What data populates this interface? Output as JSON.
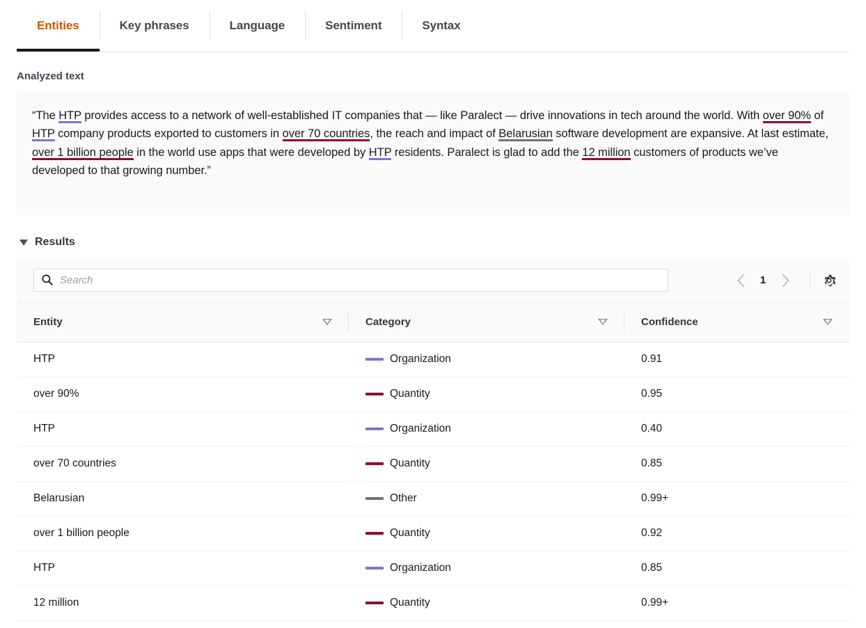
{
  "tabs": [
    {
      "label": "Entities",
      "active": true
    },
    {
      "label": "Key phrases",
      "active": false
    },
    {
      "label": "Language",
      "active": false
    },
    {
      "label": "Sentiment",
      "active": false
    },
    {
      "label": "Syntax",
      "active": false
    }
  ],
  "analyzed": {
    "section_label": "Analyzed text",
    "segments": [
      {
        "text": "“The ",
        "type": "plain"
      },
      {
        "text": "HTP",
        "type": "org"
      },
      {
        "text": " provides access to a network of well-established IT companies that — like Paralect — drive innovations in tech around the world. With ",
        "type": "plain"
      },
      {
        "text": "over 90%",
        "type": "qty"
      },
      {
        "text": " of ",
        "type": "plain"
      },
      {
        "text": "HTP",
        "type": "org"
      },
      {
        "text": " company products exported to customers in ",
        "type": "plain"
      },
      {
        "text": "over 70 countries",
        "type": "qty"
      },
      {
        "text": ", the reach and impact of ",
        "type": "plain"
      },
      {
        "text": "Belarusian",
        "type": "other"
      },
      {
        "text": " software development are expansive. At last estimate, ",
        "type": "plain"
      },
      {
        "text": "over 1 billion people",
        "type": "qty"
      },
      {
        "text": " in the world use apps that were developed by ",
        "type": "plain"
      },
      {
        "text": "HTP",
        "type": "org"
      },
      {
        "text": " residents. Paralect is glad to add the ",
        "type": "plain"
      },
      {
        "text": "12 million",
        "type": "qty"
      },
      {
        "text": " customers of products we’ve developed to that growing number.”",
        "type": "plain"
      }
    ]
  },
  "results": {
    "title": "Results",
    "search": {
      "placeholder": "Search",
      "value": ""
    },
    "pagination": {
      "page": "1",
      "prev_icon": "chevron-left-icon",
      "next_icon": "chevron-right-icon"
    },
    "settings_icon": "gear-icon",
    "columns": [
      {
        "label": "Entity",
        "sortable": true
      },
      {
        "label": "Category",
        "sortable": true
      },
      {
        "label": "Confidence",
        "sortable": true
      }
    ],
    "rows": [
      {
        "entity": "HTP",
        "category": "Organization",
        "confidence": "0.91",
        "color": "#7b78c8"
      },
      {
        "entity": "over 90%",
        "category": "Quantity",
        "confidence": "0.95",
        "color": "#8b0e2d"
      },
      {
        "entity": "HTP",
        "category": "Organization",
        "confidence": "0.40",
        "color": "#7b78c8"
      },
      {
        "entity": "over 70 countries",
        "category": "Quantity",
        "confidence": "0.85",
        "color": "#8b0e2d"
      },
      {
        "entity": "Belarusian",
        "category": "Other",
        "confidence": "0.99+",
        "color": "#6d7378"
      },
      {
        "entity": "over 1 billion people",
        "category": "Quantity",
        "confidence": "0.92",
        "color": "#8b0e2d"
      },
      {
        "entity": "HTP",
        "category": "Organization",
        "confidence": "0.85",
        "color": "#7b78c8"
      },
      {
        "entity": "12 million",
        "category": "Quantity",
        "confidence": "0.99+",
        "color": "#8b0e2d"
      }
    ]
  },
  "colors": {
    "accent_active_tab": "#d35400",
    "organization": "#7b78c8",
    "quantity": "#8b0e2d",
    "other": "#6d7378"
  }
}
